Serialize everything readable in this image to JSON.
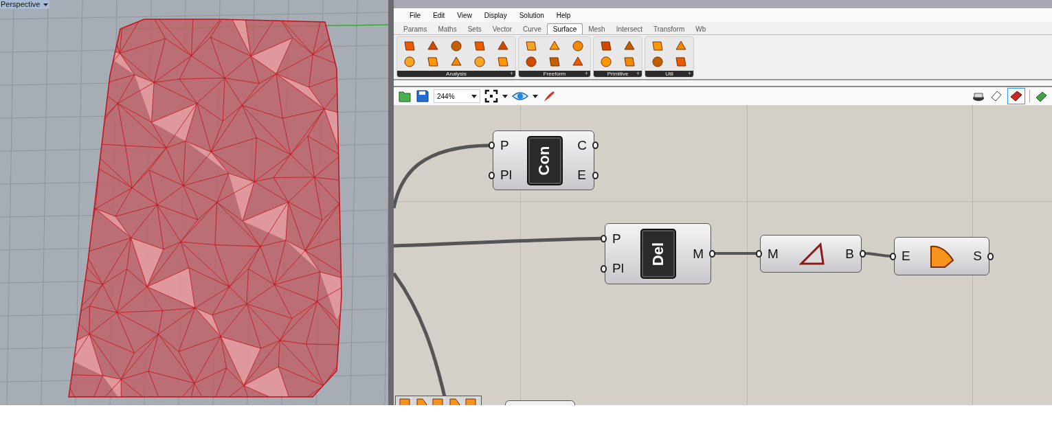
{
  "viewport": {
    "label": "Perspective"
  },
  "menu": [
    "File",
    "Edit",
    "View",
    "Display",
    "Solution",
    "Help"
  ],
  "tabs": [
    {
      "label": "Params",
      "selected": false
    },
    {
      "label": "Maths",
      "selected": false
    },
    {
      "label": "Sets",
      "selected": false
    },
    {
      "label": "Vector",
      "selected": false
    },
    {
      "label": "Curve",
      "selected": false
    },
    {
      "label": "Surface",
      "selected": true
    },
    {
      "label": "Mesh",
      "selected": false
    },
    {
      "label": "Intersect",
      "selected": false
    },
    {
      "label": "Transform",
      "selected": false
    },
    {
      "label": "Wb",
      "selected": false
    }
  ],
  "ribbon_groups": [
    {
      "label": "Analysis",
      "expand": "+"
    },
    {
      "label": "Freeform",
      "expand": "+"
    },
    {
      "label": "Primitive",
      "expand": "+"
    },
    {
      "label": "Util",
      "expand": "+"
    }
  ],
  "toolbar": {
    "zoom": "244%"
  },
  "nodes": [
    {
      "kind": "named",
      "name": "Con",
      "inputs": [
        "P",
        "Pl"
      ],
      "outputs": [
        "C",
        "E"
      ]
    },
    {
      "kind": "named",
      "name": "Del",
      "inputs": [
        "P",
        "Pl"
      ],
      "outputs": [
        "M"
      ]
    },
    {
      "kind": "icon",
      "inputs": [
        "M"
      ],
      "outputs": [
        "B"
      ]
    },
    {
      "kind": "icon",
      "inputs": [
        "E"
      ],
      "outputs": [
        "S"
      ]
    }
  ]
}
